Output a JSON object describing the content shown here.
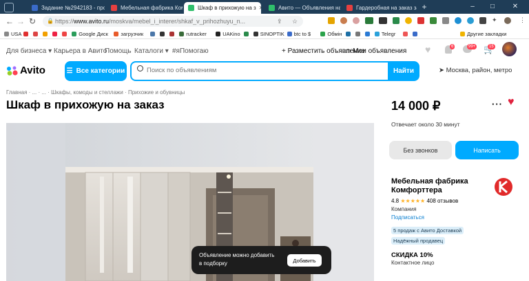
{
  "browser": {
    "tabs": [
      {
        "label": "Задание №2942183 - про",
        "fav": "#3a6bc9"
      },
      {
        "label": "Мебельная фабрика Ком",
        "fav": "#e64040"
      },
      {
        "label": "Шкаф в прихожую на з",
        "fav": "#2fbf6b"
      },
      {
        "label": "Авито — Объявления на",
        "fav": "#2fbf6b"
      },
      {
        "label": "Гардеробная на заказ за",
        "fav": "#e64040"
      }
    ],
    "url_prefix": "https://",
    "url_domain": "www.avito.ru",
    "url_path": "/moskva/mebel_i_interer/shkaf_v_prihozhuyu_n...",
    "bookmarks": [
      {
        "label": "USA",
        "color": "#888888"
      },
      {
        "label": "",
        "color": "#e03030"
      },
      {
        "label": "",
        "color": "#d44"
      },
      {
        "label": "",
        "color": "#f2a100"
      },
      {
        "label": "",
        "color": "#e24"
      },
      {
        "label": "",
        "color": "#e44"
      },
      {
        "label": "Google Диск",
        "color": "#2a9d5b"
      },
      {
        "label": "загрузчик",
        "color": "#e85b2b"
      },
      {
        "label": "",
        "color": "#4a76a8"
      },
      {
        "label": "",
        "color": "#333"
      },
      {
        "label": "",
        "color": "#aa3333"
      },
      {
        "label": "rutracker",
        "color": "#3a6b3a"
      },
      {
        "label": "UAKino",
        "color": "#222"
      },
      {
        "label": "",
        "color": "#2a8a4a"
      },
      {
        "label": "SINOPTIK",
        "color": "#333"
      },
      {
        "label": "btc to $",
        "color": "#3a6bc9"
      },
      {
        "label": "Обмін",
        "color": "#2aa24a"
      },
      {
        "label": "",
        "color": "#1d6fa5"
      },
      {
        "label": "",
        "color": "#777"
      },
      {
        "label": "",
        "color": "#2a7ad4"
      },
      {
        "label": "Telegr",
        "color": "#2aa1da"
      },
      {
        "label": "",
        "color": "#e55"
      },
      {
        "label": "",
        "color": "#3a6bc9"
      },
      {
        "label": "Другие закладки",
        "color": "#f0b400"
      }
    ]
  },
  "header": {
    "links": [
      "Для бизнеса",
      "Карьера в Авито",
      "Помощь",
      "Каталоги",
      "#яПомогаю"
    ],
    "post_ad": "Разместить объявление",
    "my_ads": "Мои объявления",
    "badges": [
      "6",
      "99+",
      "15"
    ],
    "logo": "Avito",
    "categories_button": "Все категории",
    "search_placeholder": "Поиск по объявлениям",
    "search_button": "Найти",
    "location": "Москва, район, метро"
  },
  "breadcrumbs": [
    "Главная",
    "...",
    "...",
    "Шкафы, комоды и стеллажи",
    "Прихожие и обувницы"
  ],
  "listing": {
    "title": "Шкаф в прихожую на заказ",
    "price": "14 000 ₽",
    "response_time": "Отвечает около 30 минут",
    "no_calls_button": "Без звонков",
    "write_button": "Написать"
  },
  "seller": {
    "name": "Мебельная фабрика Комфорттера",
    "rating": "4.8",
    "stars": 4.8,
    "reviews": "408 отзывов",
    "type": "Компания",
    "subscribe": "Подписаться",
    "badges": [
      "5 продаж с Авито Доставкой",
      "Надёжный продавец"
    ],
    "discount": "СКИДКА 10%",
    "contact": "Контактное лицо"
  },
  "toast": {
    "text_line1": "Объявление можно добавить",
    "text_line2": "в подборку",
    "button": "Добавить"
  },
  "colors": {
    "accent": "#00aaff",
    "heart": "#e0223e",
    "chrome_dark": "#1f3d57"
  }
}
